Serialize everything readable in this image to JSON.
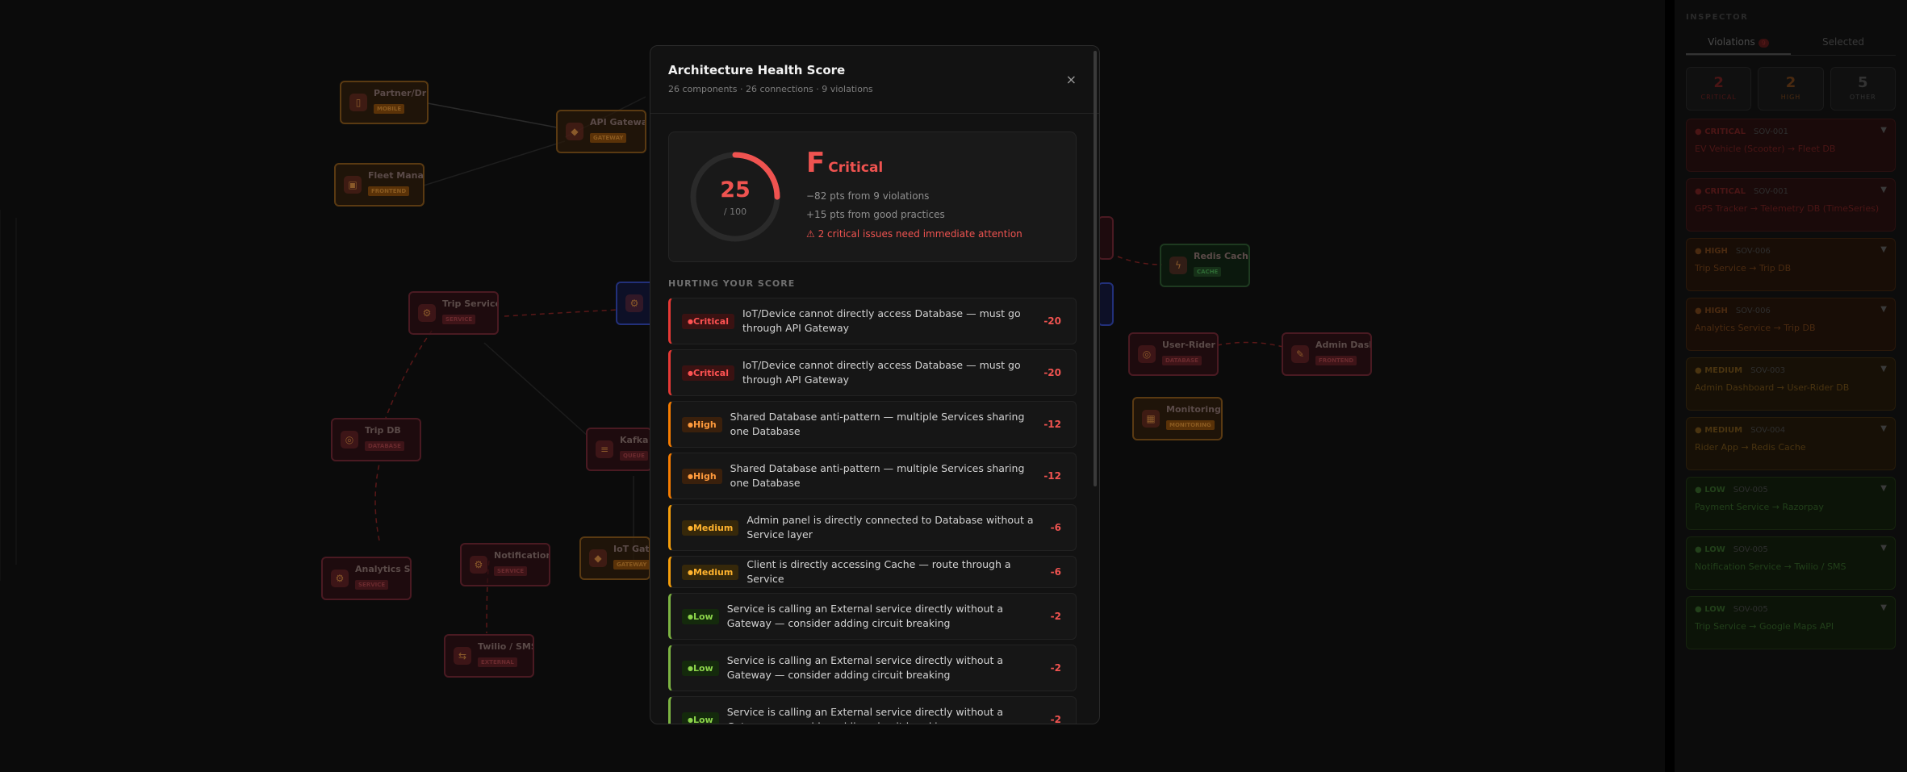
{
  "canvas": {
    "nodes": [
      {
        "name": "Partner/Driver...",
        "type": "MOBILE",
        "color": "orange",
        "icon": "phone-icon"
      },
      {
        "name": "API Gateway (K...",
        "type": "GATEWAY",
        "color": "orange",
        "icon": "gateway-icon"
      },
      {
        "name": "Fleet Manager...",
        "type": "FRONTEND",
        "color": "orange",
        "icon": "monitor-icon"
      },
      {
        "name": "Trip Service",
        "type": "SERVICE",
        "color": "red",
        "icon": "service-icon"
      },
      {
        "name": "Trip DB",
        "type": "DATABASE",
        "color": "red",
        "icon": "database-icon"
      },
      {
        "name": "Kafka E...",
        "type": "QUEUE",
        "color": "red",
        "icon": "queue-icon"
      },
      {
        "name": "Analytics Serv...",
        "type": "SERVICE",
        "color": "red",
        "icon": "service-icon"
      },
      {
        "name": "Notification S...",
        "type": "SERVICE",
        "color": "red",
        "icon": "service-icon"
      },
      {
        "name": "IoT Gatew...",
        "type": "GATEWAY",
        "color": "orange",
        "icon": "gateway-icon"
      },
      {
        "name": "Twilio / SMS",
        "type": "EXTERNAL",
        "color": "red",
        "icon": "external-icon"
      },
      {
        "name": "Redis Cache",
        "type": "CACHE",
        "color": "green",
        "icon": "cache-icon"
      },
      {
        "name": "User-Rider DB",
        "type": "DATABASE",
        "color": "red",
        "icon": "database-icon"
      },
      {
        "name": "Admin Dashbo...",
        "type": "FRONTEND",
        "color": "red",
        "icon": "admin-icon"
      },
      {
        "name": "Monitoring (Da...",
        "type": "MONITORING",
        "color": "orange",
        "icon": "chart-icon"
      }
    ]
  },
  "inspector": {
    "title": "INSPECTOR",
    "tabs": [
      {
        "label": "Violations",
        "count": "9"
      },
      {
        "label": "Selected"
      }
    ],
    "stats": [
      {
        "num": "2",
        "label": "CRITICAL",
        "color": "#4a1515"
      },
      {
        "num": "2",
        "label": "HIGH",
        "color": "#4a2a10"
      },
      {
        "num": "5",
        "label": "OTHER",
        "color": "#333333"
      }
    ],
    "items": [
      {
        "severity": "CRITICAL",
        "code": "SOV-001",
        "path": "EV Vehicle (Scooter) → Fleet DB",
        "bg": "#1a0a0a",
        "border": "#2a1010",
        "color": "#4a1515"
      },
      {
        "severity": "CRITICAL",
        "code": "SOV-001",
        "path": "GPS Tracker → Telemetry DB (TimeSeries)",
        "bg": "#1a0a0a",
        "border": "#2a1010",
        "color": "#4a1515"
      },
      {
        "severity": "HIGH",
        "code": "SOV-006",
        "path": "Trip Service → Trip DB",
        "bg": "#180d06",
        "border": "#2a180a",
        "color": "#4a2a10"
      },
      {
        "severity": "HIGH",
        "code": "SOV-006",
        "path": "Analytics Service → Trip DB",
        "bg": "#180d06",
        "border": "#2a180a",
        "color": "#4a2a10"
      },
      {
        "severity": "MEDIUM",
        "code": "SOV-003",
        "path": "Admin Dashboard → User-Rider DB",
        "bg": "#171006",
        "border": "#271c0a",
        "color": "#4a3410"
      },
      {
        "severity": "MEDIUM",
        "code": "SOV-004",
        "path": "Rider App → Redis Cache",
        "bg": "#171006",
        "border": "#271c0a",
        "color": "#4a3410"
      },
      {
        "severity": "LOW",
        "code": "SOV-005",
        "path": "Payment Service → Razorpay",
        "bg": "#0c1408",
        "border": "#16240e",
        "color": "#22401a"
      },
      {
        "severity": "LOW",
        "code": "SOV-005",
        "path": "Notification Service → Twilio / SMS",
        "bg": "#0c1408",
        "border": "#16240e",
        "color": "#22401a"
      },
      {
        "severity": "LOW",
        "code": "SOV-005",
        "path": "Trip Service → Google Maps API",
        "bg": "#0c1408",
        "border": "#16240e",
        "color": "#22401a"
      }
    ]
  },
  "modal": {
    "title": "Architecture Health Score",
    "subtitle": "26 components · 26 connections · 9 violations",
    "close": "×",
    "score": {
      "value": "25",
      "max": "/ 100",
      "fraction": 0.25,
      "grade": "F",
      "grade_label": "Critical",
      "line1": "−82 pts from 9 violations",
      "line2": "+15 pts from good practices",
      "warning": "⚠ 2 critical issues need immediate attention"
    },
    "section_label": "HURTING YOUR SCORE",
    "violations": [
      {
        "severity": "Critical",
        "level": "critical",
        "text": "IoT/Device cannot directly access Database — must go through API Gateway",
        "points": "-20"
      },
      {
        "severity": "Critical",
        "level": "critical",
        "text": "IoT/Device cannot directly access Database — must go through API Gateway",
        "points": "-20"
      },
      {
        "severity": "High",
        "level": "high",
        "text": "Shared Database anti-pattern — multiple Services sharing one Database",
        "points": "-12"
      },
      {
        "severity": "High",
        "level": "high",
        "text": "Shared Database anti-pattern — multiple Services sharing one Database",
        "points": "-12"
      },
      {
        "severity": "Medium",
        "level": "medium",
        "text": "Admin panel is directly connected to Database without a Service layer",
        "points": "-6"
      },
      {
        "severity": "Medium",
        "level": "medium",
        "text": "Client is directly accessing Cache — route through a Service",
        "points": "-6",
        "short": true
      },
      {
        "severity": "Low",
        "level": "low",
        "text": "Service is calling an External service directly without a Gateway — consider adding circuit breaking",
        "points": "-2"
      },
      {
        "severity": "Low",
        "level": "low",
        "text": "Service is calling an External service directly without a Gateway — consider adding circuit breaking",
        "points": "-2"
      },
      {
        "severity": "Low",
        "level": "low",
        "text": "Service is calling an External service directly without a Gateway — consider adding circuit breaking",
        "points": "-2"
      }
    ]
  }
}
